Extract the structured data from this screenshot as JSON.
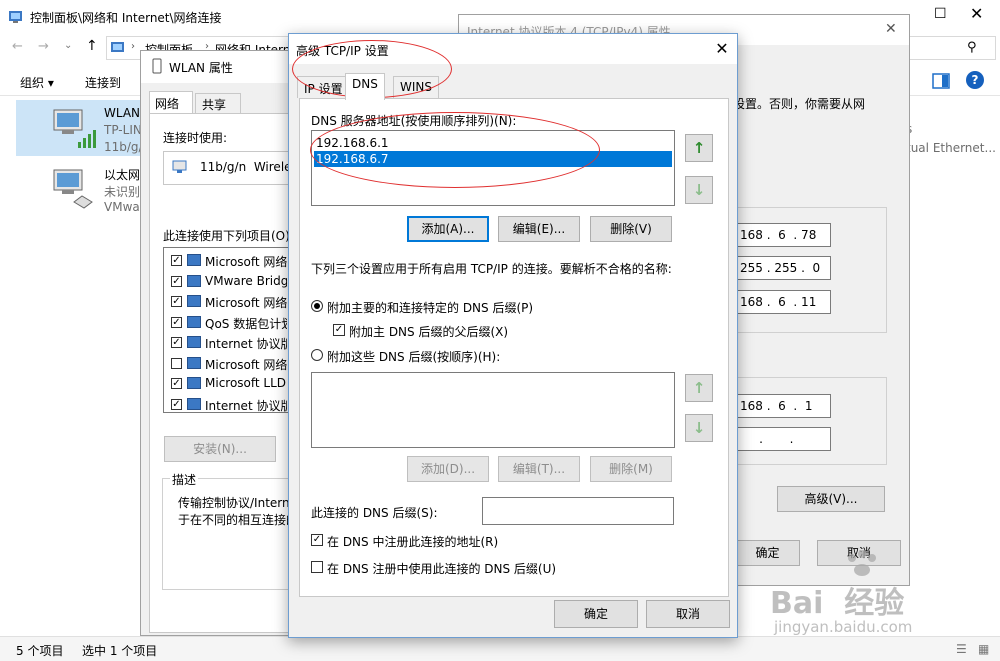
{
  "explorer": {
    "title": "控制面板\\网络和 Internet\\网络连接",
    "breadcrumb": [
      "控制面板",
      "网络和 Internet"
    ],
    "toolbar": {
      "organize": "组织 ▾",
      "connect_to": "连接到"
    },
    "items": [
      {
        "name": "WLAN",
        "line2": "TP-LIN",
        "line3": "11b/g/"
      },
      {
        "name": "以太网",
        "line2": "未识别",
        "line3": "VMwa"
      }
    ],
    "right_text": [
      "s",
      "tual Ethernet..."
    ],
    "status": {
      "count": "5 个项目",
      "selected": "选中 1 个项目"
    }
  },
  "ipv4": {
    "title": "Internet 协议版本 4 (TCP/IPv4) 属性",
    "info_text": "设置。否则，你需要从网",
    "ip_address": "168 .  6  . 78",
    "subnet_mask": "255 . 255 .  0",
    "gateway": "168 .  6  . 11",
    "dns_preferred": "168 .  6  .  1",
    "dns_alternate": "     .       .",
    "advanced_label": "高级(V)...",
    "ok_label": "确定",
    "cancel_label": "取消"
  },
  "wlan": {
    "title": "WLAN 属性",
    "tabs": [
      "网络",
      "共享"
    ],
    "connect_using_label": "连接时使用:",
    "adapter": "11b/g/n  Wirele",
    "items_label": "此连接使用下列项目(O):",
    "items": [
      {
        "label": "Microsoft 网络",
        "checked": true
      },
      {
        "label": "VMware Bridg",
        "checked": true
      },
      {
        "label": "Microsoft 网络",
        "checked": true
      },
      {
        "label": "QoS 数据包计划",
        "checked": true
      },
      {
        "label": "Internet 协议版",
        "checked": true
      },
      {
        "label": "Microsoft 网络",
        "checked": false
      },
      {
        "label": "Microsoft LLDP",
        "checked": true
      },
      {
        "label": "Internet 协议版",
        "checked": true
      }
    ],
    "install_label": "安装(N)...",
    "description_label": "描述",
    "description_text": [
      "传输控制协议/Intern",
      "于在不同的相互连接的"
    ]
  },
  "advanced": {
    "title": "高级 TCP/IP 设置",
    "close_glyph": "✕",
    "tabs": [
      "IP 设置",
      "DNS",
      "WINS"
    ],
    "dns_servers_label": "DNS 服务器地址(按使用顺序排列)(N):",
    "dns_servers": [
      "192.168.6.1",
      "192.168.6.7"
    ],
    "selected_server_index": 1,
    "add_label": "添加(A)...",
    "edit_label": "编辑(E)...",
    "remove_label": "删除(V)",
    "info_text": "下列三个设置应用于所有启用 TCP/IP 的连接。要解析不合格的名称:",
    "radio_primary_label": "附加主要的和连接特定的 DNS 后缀(P)",
    "checkbox_parent_label": "附加主 DNS 后缀的父后缀(X)",
    "radio_these_label": "附加这些 DNS 后缀(按顺序)(H):",
    "suffix_add_label": "添加(D)...",
    "suffix_edit_label": "编辑(T)...",
    "suffix_remove_label": "删除(M)",
    "conn_suffix_label": "此连接的 DNS 后缀(S):",
    "register_label": "在 DNS 中注册此连接的地址(R)",
    "use_suffix_label": "在 DNS 注册中使用此连接的 DNS 后缀(U)",
    "ok_label": "确定",
    "cancel_label": "取消"
  },
  "watermark": {
    "brand": "Bai  经验",
    "url": "jingyan.baidu.com"
  },
  "colors": {
    "accent": "#0078d7",
    "annotation": "#e03030",
    "panel": "#f0f0f0"
  }
}
